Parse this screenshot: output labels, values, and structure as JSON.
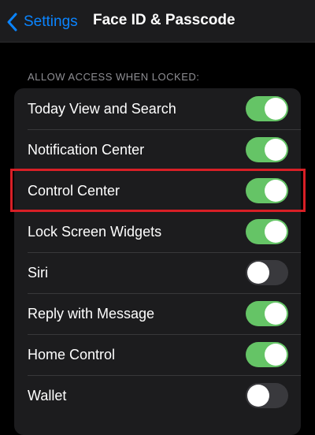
{
  "navbar": {
    "back_label": "Settings",
    "title": "Face ID & Passcode"
  },
  "section": {
    "header": "ALLOW ACCESS WHEN LOCKED:"
  },
  "items": [
    {
      "label": "Today View and Search",
      "on": true
    },
    {
      "label": "Notification Center",
      "on": true
    },
    {
      "label": "Control Center",
      "on": true
    },
    {
      "label": "Lock Screen Widgets",
      "on": true
    },
    {
      "label": "Siri",
      "on": false
    },
    {
      "label": "Reply with Message",
      "on": true
    },
    {
      "label": "Home Control",
      "on": true
    },
    {
      "label": "Wallet",
      "on": false
    }
  ],
  "colors": {
    "accent": "#0a84ff",
    "toggle_on": "#65c466",
    "toggle_off": "#39393d",
    "highlight": "#d81f26"
  },
  "icons": {
    "back": "chevron-left-icon"
  }
}
